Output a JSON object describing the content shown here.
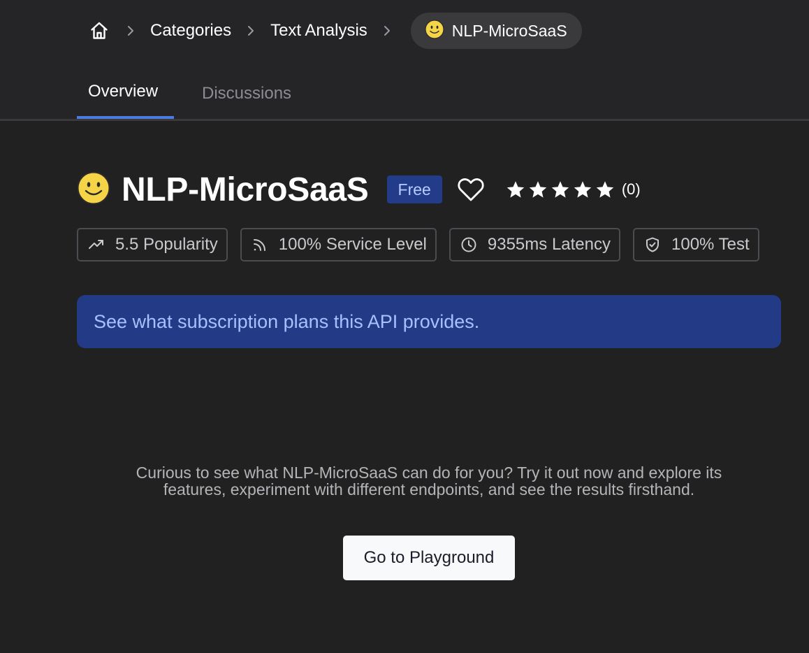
{
  "breadcrumb": {
    "home_icon": "home-icon",
    "separator_icon": "chevron-right-icon",
    "items": [
      "Categories",
      "Text Analysis"
    ],
    "current": "NLP-MicroSaaS"
  },
  "tabs": [
    {
      "label": "Overview",
      "active": true
    },
    {
      "label": "Discussions",
      "active": false
    }
  ],
  "api": {
    "name": "NLP-MicroSaaS",
    "logo_icon": "smiley-face-icon",
    "pricing_badge": "Free",
    "favorite_icon": "heart-icon",
    "rating": {
      "stars": 5,
      "star_icon": "star-icon",
      "count_label": "(0)"
    }
  },
  "stats": [
    {
      "icon": "trending-up-icon",
      "label": "5.5 Popularity"
    },
    {
      "icon": "signal-icon",
      "label": "100% Service Level"
    },
    {
      "icon": "clock-icon",
      "label": "9355ms Latency"
    },
    {
      "icon": "shield-check-icon",
      "label": "100% Test"
    }
  ],
  "plans_banner": {
    "text": "See what subscription plans this API provides."
  },
  "cta": {
    "line1": "Curious to see what NLP-MicroSaaS can do for you? Try it out now and explore its",
    "line2": "features, experiment with different endpoints, and see the results firsthand.",
    "button_label": "Go to Playground"
  },
  "colors": {
    "background": "#212121",
    "header": "#252527",
    "accent": "#4c7be0",
    "banner": "#233a87",
    "badge": "#233c8a"
  }
}
